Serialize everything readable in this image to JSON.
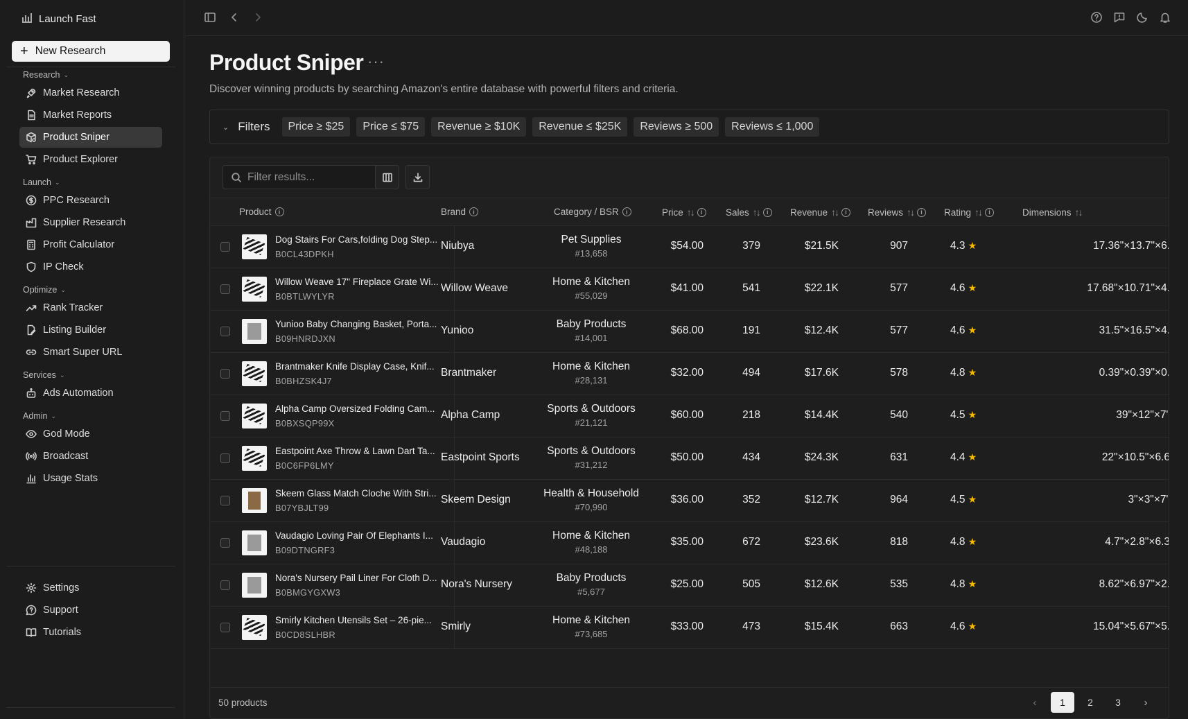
{
  "app": {
    "name": "Launch Fast"
  },
  "sidebar": {
    "new_button": "New Research",
    "sections": {
      "research": "Research",
      "launch": "Launch",
      "optimize": "Optimize",
      "services": "Services",
      "admin": "Admin"
    },
    "items": {
      "market_research": "Market Research",
      "market_reports": "Market Reports",
      "product_sniper": "Product Sniper",
      "product_explorer": "Product Explorer",
      "ppc_research": "PPC Research",
      "supplier_research": "Supplier Research",
      "profit_calculator": "Profit Calculator",
      "ip_check": "IP Check",
      "rank_tracker": "Rank Tracker",
      "listing_builder": "Listing Builder",
      "smart_super_url": "Smart Super URL",
      "ads_automation": "Ads Automation",
      "god_mode": "God Mode",
      "broadcast": "Broadcast",
      "usage_stats": "Usage Stats",
      "settings": "Settings",
      "support": "Support",
      "tutorials": "Tutorials"
    },
    "active": "Product Sniper"
  },
  "page": {
    "title": "Product Sniper",
    "subtitle": "Discover winning products by searching Amazon's entire database with powerful filters and criteria."
  },
  "filters": {
    "label": "Filters",
    "chips": [
      "Price ≥ $25",
      "Price ≤ $75",
      "Revenue ≥ $10K",
      "Revenue ≤ $25K",
      "Reviews ≥ 500",
      "Reviews ≤ 1,000"
    ]
  },
  "table": {
    "search_placeholder": "Filter results...",
    "headers": {
      "product": "Product",
      "brand": "Brand",
      "category": "Category / BSR",
      "price": "Price",
      "sales": "Sales",
      "revenue": "Revenue",
      "reviews": "Reviews",
      "rating": "Rating",
      "dimensions": "Dimensions"
    },
    "rows": [
      {
        "name": "Dog Stairs For Cars,folding Dog Step...",
        "asin": "B0CL43DPKH",
        "brand": "Niubya",
        "category": "Pet Supplies",
        "bsr": "#13,658",
        "price": "$54.00",
        "sales": "379",
        "revenue": "$21.5K",
        "reviews": "907",
        "rating": "4.3",
        "dims": "17.36\"×13.7\"×6."
      },
      {
        "name": "Willow Weave 17\" Fireplace Grate Wi...",
        "asin": "B0BTLWYLYR",
        "brand": "Willow Weave",
        "category": "Home & Kitchen",
        "bsr": "#55,029",
        "price": "$41.00",
        "sales": "541",
        "revenue": "$22.1K",
        "reviews": "577",
        "rating": "4.6",
        "dims": "17.68\"×10.71\"×4."
      },
      {
        "name": "Yunioo Baby Changing Basket, Porta...",
        "asin": "B09HNRDJXN",
        "brand": "Yunioo",
        "category": "Baby Products",
        "bsr": "#14,001",
        "price": "$68.00",
        "sales": "191",
        "revenue": "$12.4K",
        "reviews": "577",
        "rating": "4.6",
        "dims": "31.5\"×16.5\"×4."
      },
      {
        "name": "Brantmaker Knife Display Case, Knif...",
        "asin": "B0BHZSK4J7",
        "brand": "Brantmaker",
        "category": "Home & Kitchen",
        "bsr": "#28,131",
        "price": "$32.00",
        "sales": "494",
        "revenue": "$17.6K",
        "reviews": "578",
        "rating": "4.8",
        "dims": "0.39\"×0.39\"×0."
      },
      {
        "name": "Alpha Camp Oversized Folding Cam...",
        "asin": "B0BXSQP99X",
        "brand": "Alpha Camp",
        "category": "Sports & Outdoors",
        "bsr": "#21,121",
        "price": "$60.00",
        "sales": "218",
        "revenue": "$14.4K",
        "reviews": "540",
        "rating": "4.5",
        "dims": "39\"×12\"×7\""
      },
      {
        "name": "Eastpoint Axe Throw & Lawn Dart Ta...",
        "asin": "B0C6FP6LMY",
        "brand": "Eastpoint Sports",
        "category": "Sports & Outdoors",
        "bsr": "#31,212",
        "price": "$50.00",
        "sales": "434",
        "revenue": "$24.3K",
        "reviews": "631",
        "rating": "4.4",
        "dims": "22\"×10.5\"×6.6"
      },
      {
        "name": "Skeem Glass Match Cloche With Stri...",
        "asin": "B07YBJLT99",
        "brand": "Skeem Design",
        "category": "Health & Household",
        "bsr": "#70,990",
        "price": "$36.00",
        "sales": "352",
        "revenue": "$12.7K",
        "reviews": "964",
        "rating": "4.5",
        "dims": "3\"×3\"×7\""
      },
      {
        "name": "Vaudagio Loving Pair Of Elephants I...",
        "asin": "B09DTNGRF3",
        "brand": "Vaudagio",
        "category": "Home & Kitchen",
        "bsr": "#48,188",
        "price": "$35.00",
        "sales": "672",
        "revenue": "$23.6K",
        "reviews": "818",
        "rating": "4.8",
        "dims": "4.7\"×2.8\"×6.3"
      },
      {
        "name": "Nora's Nursery Pail Liner For Cloth D...",
        "asin": "B0BMGYGXW3",
        "brand": "Nora's Nursery",
        "category": "Baby Products",
        "bsr": "#5,677",
        "price": "$25.00",
        "sales": "505",
        "revenue": "$12.6K",
        "reviews": "535",
        "rating": "4.8",
        "dims": "8.62\"×6.97\"×2."
      },
      {
        "name": "Smirly Kitchen Utensils Set – 26-pie...",
        "asin": "B0CD8SLHBR",
        "brand": "Smirly",
        "category": "Home & Kitchen",
        "bsr": "#73,685",
        "price": "$33.00",
        "sales": "473",
        "revenue": "$15.4K",
        "reviews": "663",
        "rating": "4.6",
        "dims": "15.04\"×5.67\"×5."
      }
    ],
    "footer_count": "50 products",
    "pages": [
      "1",
      "2",
      "3"
    ],
    "current_page": "1"
  }
}
